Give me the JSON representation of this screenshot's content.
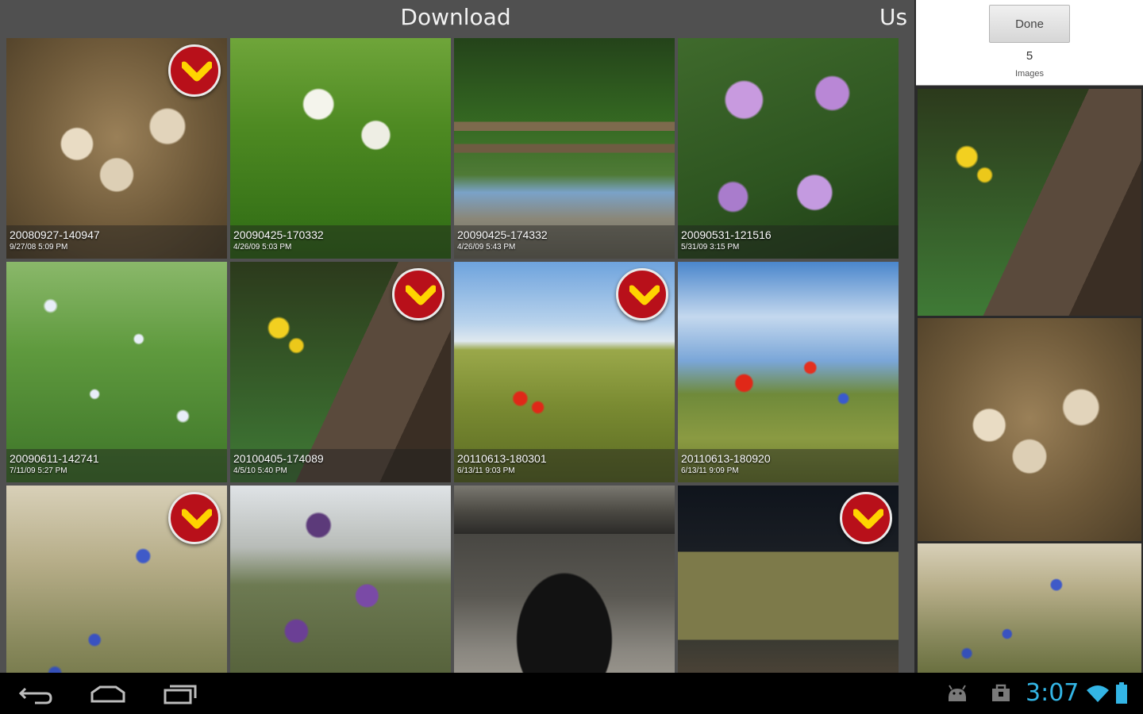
{
  "header": {
    "title": "Download",
    "next_title": "Us"
  },
  "grid": {
    "items": [
      {
        "name": "20080927-140947",
        "date": "9/27/08 5:09 PM",
        "selected": true,
        "scene": "seed-brown"
      },
      {
        "name": "20090425-170332",
        "date": "4/26/09 5:03 PM",
        "selected": false,
        "scene": "dandelion-green"
      },
      {
        "name": "20090425-174332",
        "date": "4/26/09 5:43 PM",
        "selected": false,
        "scene": "bench-garden"
      },
      {
        "name": "20090531-121516",
        "date": "5/31/09 3:15 PM",
        "selected": false,
        "scene": "mallow-purple"
      },
      {
        "name": "20090611-142741",
        "date": "7/11/09 5:27 PM",
        "selected": false,
        "scene": "white-meadow"
      },
      {
        "name": "20100405-174089",
        "date": "4/5/10 5:40 PM",
        "selected": true,
        "scene": "tree-yellow-flowers"
      },
      {
        "name": "20110613-180301",
        "date": "6/13/11 9:03 PM",
        "selected": true,
        "scene": "poppy-field"
      },
      {
        "name": "20110613-180920",
        "date": "6/13/11 9:09 PM",
        "selected": false,
        "scene": "poppy-sky"
      },
      {
        "name": "",
        "date": "",
        "selected": true,
        "scene": "grass-cornflower"
      },
      {
        "name": "",
        "date": "",
        "selected": false,
        "scene": "purple-wildflower"
      },
      {
        "name": "",
        "date": "",
        "selected": false,
        "scene": "black-jeep-garage"
      },
      {
        "name": "",
        "date": "",
        "selected": true,
        "scene": "house-night"
      }
    ]
  },
  "side_panel": {
    "done_label": "Done",
    "count": "5",
    "count_label": "Images",
    "selected_scenes": [
      "tree-yellow-flowers",
      "seed-brown",
      "grass-cornflower"
    ]
  },
  "system_bar": {
    "clock": "3:07",
    "icons": [
      "back-icon",
      "home-icon",
      "recent-apps-icon",
      "android-debug-icon",
      "shopping-bag-icon",
      "wifi-icon",
      "battery-icon"
    ],
    "accent_color": "#33b5e5"
  },
  "colors": {
    "badge_red": "#b8101a",
    "badge_chevron": "#ffd400",
    "panel_bg": "#505050"
  }
}
